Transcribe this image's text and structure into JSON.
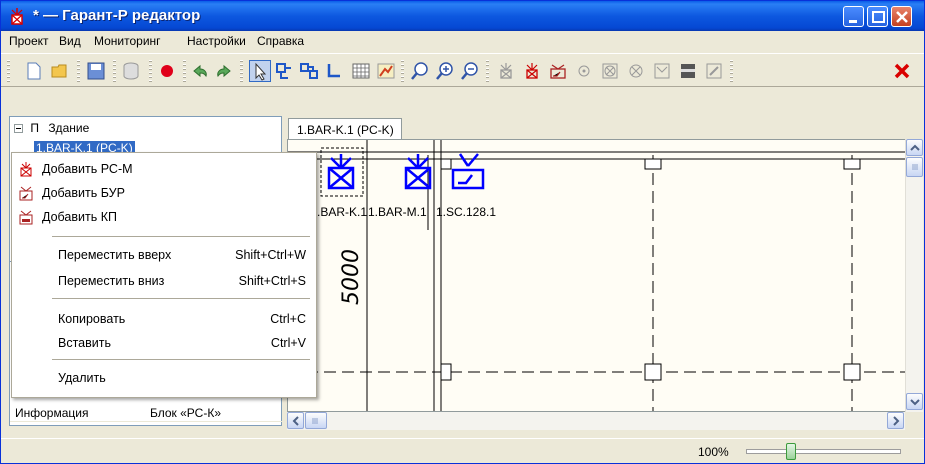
{
  "window": {
    "title": "* — Гарант-Р редактор",
    "buttons": [
      "minimize-button",
      "maximize-button",
      "close-button"
    ]
  },
  "menu": [
    "Проект",
    "Вид",
    "Мониторинг",
    "Настройки",
    "Справка"
  ],
  "toolbar": {
    "icons": [
      "new-file-icon",
      "open-folder-icon",
      "save-icon",
      "database-icon",
      "record-icon",
      "undo-icon",
      "redo-icon",
      "pointer-icon",
      "add-element-icon",
      "group-icon",
      "line-icon",
      "grid-icon",
      "chart-icon",
      "zoom-fit-icon",
      "zoom-in-icon",
      "zoom-out-icon",
      "add-rs-m-icon",
      "add-rs-k-icon",
      "add-bur-icon",
      "circle-icon",
      "x-box-icon",
      "x-circle-icon",
      "filter-icon",
      "rect-icon",
      "edit-icon",
      "delete-icon"
    ],
    "accent_color": "#d90000"
  },
  "tree": {
    "root_label": "Здание",
    "child_label": "1.BAR-K.1 (PC-K)"
  },
  "properties": {
    "rows": [
      {
        "key": "Информация",
        "value": "Блок «РС-К»"
      }
    ]
  },
  "context_menu": {
    "items": [
      {
        "label": "Добавить РС-М",
        "icon": "rs-m-icon"
      },
      {
        "label": "Добавить БУР",
        "icon": "bur-icon"
      },
      {
        "label": "Добавить КП",
        "icon": "kp-icon"
      }
    ],
    "move": [
      {
        "label": "Переместить вверх",
        "shortcut": "Shift+Ctrl+W"
      },
      {
        "label": "Переместить вниз",
        "shortcut": "Shift+Ctrl+S"
      }
    ],
    "edit": [
      {
        "label": "Копировать",
        "shortcut": "Ctrl+C"
      },
      {
        "label": "Вставить",
        "shortcut": "Ctrl+V"
      }
    ],
    "delete": "Удалить"
  },
  "editor": {
    "tab_label": "1.BAR-K.1 (PC-K)",
    "dimension_label": "5000",
    "device_labels": [
      ".BAR-K.1",
      "1.BAR-M.1",
      "1.SC.128.1"
    ],
    "device_color": "#0000ff"
  },
  "status": {
    "zoom": "100%",
    "zoom_slider_fraction": 0.27
  }
}
